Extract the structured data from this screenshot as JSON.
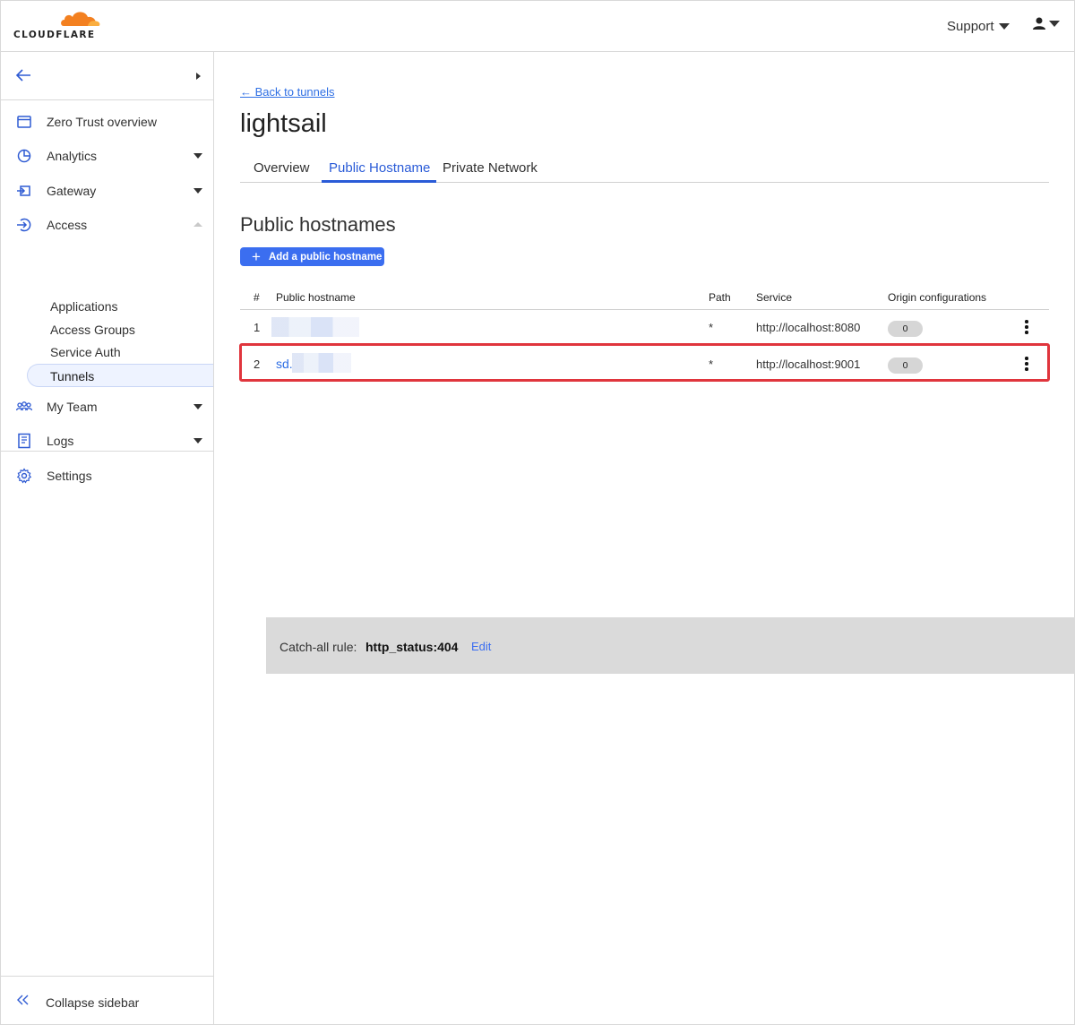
{
  "brand": {
    "name": "CLOUDFLARE",
    "logo_color": "#f38020"
  },
  "header": {
    "support_label": "Support",
    "user_icon": "user-icon"
  },
  "sidebar": {
    "items": [
      {
        "label": "Zero Trust overview",
        "icon": "window-icon"
      },
      {
        "label": "Analytics",
        "icon": "pie-chart-icon"
      },
      {
        "label": "Gateway",
        "icon": "gateway-icon"
      },
      {
        "label": "Access",
        "icon": "access-icon"
      },
      {
        "label": "My Team",
        "icon": "team-icon"
      },
      {
        "label": "Logs",
        "icon": "logs-icon"
      },
      {
        "label": "Settings",
        "icon": "gear-icon"
      }
    ],
    "access_sub": [
      "Applications",
      "Access Groups",
      "Service Auth",
      "Tunnels"
    ],
    "active_sub": "Tunnels",
    "collapse_label": "Collapse sidebar"
  },
  "main": {
    "back_link": "← Back to tunnels",
    "title": "lightsail",
    "tabs": [
      "Overview",
      "Public Hostname",
      "Private Network"
    ],
    "active_tab": "Public Hostname",
    "section_title": "Public hostnames",
    "add_button": "Add a public hostname",
    "table": {
      "headers": [
        "#",
        "Public hostname",
        "Path",
        "Service",
        "Origin configurations"
      ],
      "rows": [
        {
          "num": "1",
          "hostname": "",
          "path": "*",
          "service": "http://localhost:8080",
          "origin": "0"
        },
        {
          "num": "2",
          "hostname": "sd.",
          "path": "*",
          "service": "http://localhost:9001",
          "origin": "0"
        }
      ],
      "highlighted_row": 2
    },
    "catch_all": {
      "label": "Catch-all rule:",
      "value": "http_status:404",
      "edit": "Edit"
    }
  },
  "colors": {
    "accent": "#2a5bd7",
    "button": "#3b6ef0",
    "highlight": "#e0353d"
  }
}
